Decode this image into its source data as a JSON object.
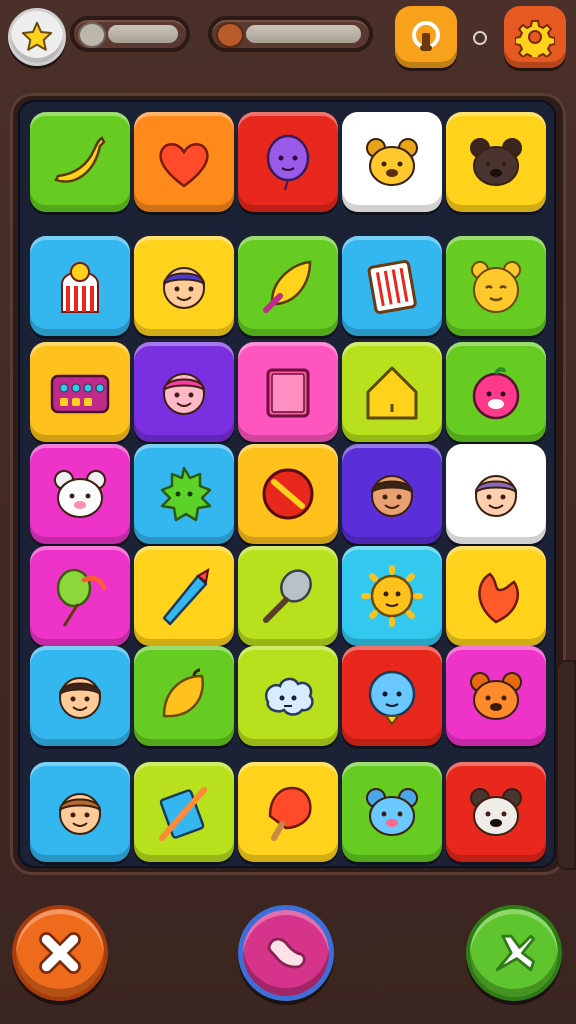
{
  "topbar": {
    "star_icon": "star-icon",
    "bar1_icon": "capsule-icon",
    "bar1_fill": 0,
    "bar2_icon": "seed-icon",
    "bar2_fill": 0,
    "music_icon": "music-icon",
    "settings_icon": "gear-icon"
  },
  "board": {
    "rows": [
      [
        {
          "color": "#66cc22",
          "icon": "banana-icon"
        },
        {
          "color": "#ff8a1c",
          "icon": "heart-icon"
        },
        {
          "color": "#e8281c",
          "icon": "balloon-face-icon"
        },
        {
          "color": "#ffffff",
          "icon": "lion-cub-icon"
        },
        {
          "color": "#ffd21c",
          "icon": "dark-cat-icon"
        }
      ],
      [
        {
          "color": "#33b7ee",
          "icon": "chef-icon"
        },
        {
          "color": "#ffd21c",
          "icon": "boy-cap-icon"
        },
        {
          "color": "#66cc22",
          "icon": "leaf-icon"
        },
        {
          "color": "#33b7ee",
          "icon": "abacus-icon"
        },
        {
          "color": "#66cc22",
          "icon": "bear-icon"
        }
      ],
      [
        {
          "color": "#ffc21c",
          "icon": "keyboard-toy-icon"
        },
        {
          "color": "#7a2fe0",
          "icon": "pink-boy-icon"
        },
        {
          "color": "#ff55bf",
          "icon": "pink-book-icon"
        },
        {
          "color": "#b8e01c",
          "icon": "house-icon"
        },
        {
          "color": "#66cc22",
          "icon": "pink-monster-icon"
        }
      ],
      [
        {
          "color": "#ee33c8",
          "icon": "white-cat-icon"
        },
        {
          "color": "#33b7ee",
          "icon": "green-splat-icon"
        },
        {
          "color": "#ffc21c",
          "icon": "ball-icon"
        },
        {
          "color": "#5a2ed8",
          "icon": "dark-boy-icon"
        },
        {
          "color": "#ffffff",
          "icon": "girl-icon"
        }
      ],
      [
        {
          "color": "#ee33c8",
          "icon": "green-balloon-icon"
        },
        {
          "color": "#ffd21c",
          "icon": "crayon-icon"
        },
        {
          "color": "#b8e01c",
          "icon": "whisk-icon"
        },
        {
          "color": "#33c8ee",
          "icon": "sun-face-icon"
        },
        {
          "color": "#ffd21c",
          "icon": "leaf-heart-icon"
        }
      ],
      [
        {
          "color": "#33b7ee",
          "icon": "boy-face-icon"
        },
        {
          "color": "#66cc22",
          "icon": "mango-icon"
        },
        {
          "color": "#b8e01c",
          "icon": "cloud-creature-icon"
        },
        {
          "color": "#e8281c",
          "icon": "blue-face-icon"
        },
        {
          "color": "#ee33c8",
          "icon": "fox-icon"
        }
      ],
      [
        {
          "color": "#33b7ee",
          "icon": "curly-boy-icon"
        },
        {
          "color": "#b8e01c",
          "icon": "pencil-book-icon"
        },
        {
          "color": "#ffd21c",
          "icon": "popsicle-icon"
        },
        {
          "color": "#66cc22",
          "icon": "blue-cat-icon"
        },
        {
          "color": "#e8281c",
          "icon": "raccoon-icon"
        }
      ]
    ]
  },
  "bottom": {
    "left_icon": "close-icon",
    "mid_icon": "bean-icon",
    "right_icon": "plane-icon"
  }
}
